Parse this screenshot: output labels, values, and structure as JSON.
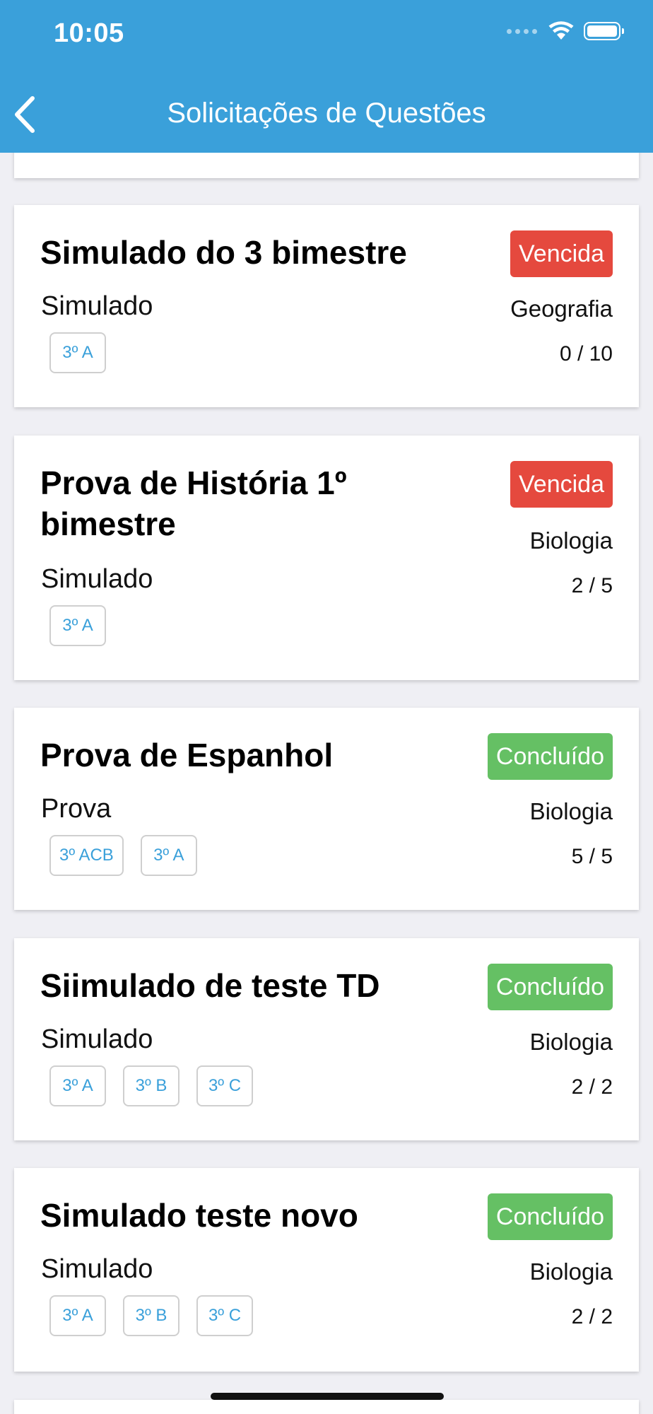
{
  "status_bar": {
    "time": "10:05"
  },
  "header": {
    "title": "Solicitações de Questões",
    "back_icon": "chevron-left-icon"
  },
  "colors": {
    "header": "#3aa0da",
    "vencida": "#e5493e",
    "concluido": "#65c064",
    "tag_text": "#3aa0da"
  },
  "requests": [
    {
      "title": "Simulado do 3 bimestre",
      "type": "Simulado",
      "status": "Vencida",
      "subject": "Geografia",
      "progress": "0 / 10",
      "classes": [
        "3º A"
      ]
    },
    {
      "title": "Prova de História 1º bimestre",
      "type": "Simulado",
      "status": "Vencida",
      "subject": "Biologia",
      "progress": "2 / 5",
      "classes": [
        "3º A"
      ]
    },
    {
      "title": "Prova de Espanhol",
      "type": "Prova",
      "status": "Concluído",
      "subject": "Biologia",
      "progress": "5 / 5",
      "classes": [
        "3º ACB",
        "3º A"
      ]
    },
    {
      "title": "Siimulado de teste TD",
      "type": "Simulado",
      "status": "Concluído",
      "subject": "Biologia",
      "progress": "2 / 2",
      "classes": [
        "3º A",
        "3º B",
        "3º C"
      ]
    },
    {
      "title": "Simulado teste novo",
      "type": "Simulado",
      "status": "Concluído",
      "subject": "Biologia",
      "progress": "2 / 2",
      "classes": [
        "3º A",
        "3º B",
        "3º C"
      ]
    }
  ]
}
